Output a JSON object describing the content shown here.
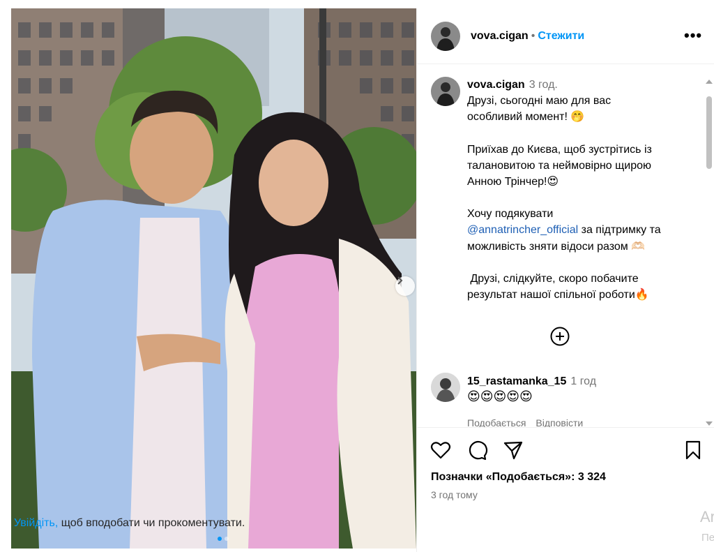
{
  "post": {
    "author": "vova.cigan",
    "follow_label": "Стежити",
    "more_label": "•••",
    "caption_time": "3 год.",
    "caption_lines": [
      "Друзі, сьогодні маю для вас",
      "особливий момент! 🤭",
      "",
      "Приїхав до Києва, щоб зустрітись із",
      "талановитою та неймовірно щирою",
      "Анною Трінчер!😍",
      "",
      "Хочу подякувати",
      "@annatrincher_official",
      " за підтримку та",
      "можливість зняти відоси разом 🫶🏻",
      "",
      " Друзі, слідкуйте, скоро побачите",
      "результат нашої спільної роботи🔥"
    ],
    "likes_text": "Позначки «Подобається»: 3 324",
    "posted_ago": "3 год тому",
    "carousel_current": 1,
    "carousel_total": 2
  },
  "comment": {
    "username": "15_rastamanka_15",
    "time": "1 год",
    "text": "😍😍😍😍😍",
    "like_label": "Подобається",
    "reply_label": "Відповісти"
  },
  "login": {
    "link": "Увійдіть,",
    "rest": " щоб вподобати чи прокоментувати."
  },
  "ghost": {
    "a": "Ar",
    "b": "Пе"
  },
  "colors": {
    "accent": "#0095f6",
    "muted": "#737373"
  },
  "icons": [
    "heart-icon",
    "comment-icon",
    "share-icon",
    "bookmark-icon",
    "add-circle-icon",
    "chevron-right-icon",
    "more-icon"
  ]
}
